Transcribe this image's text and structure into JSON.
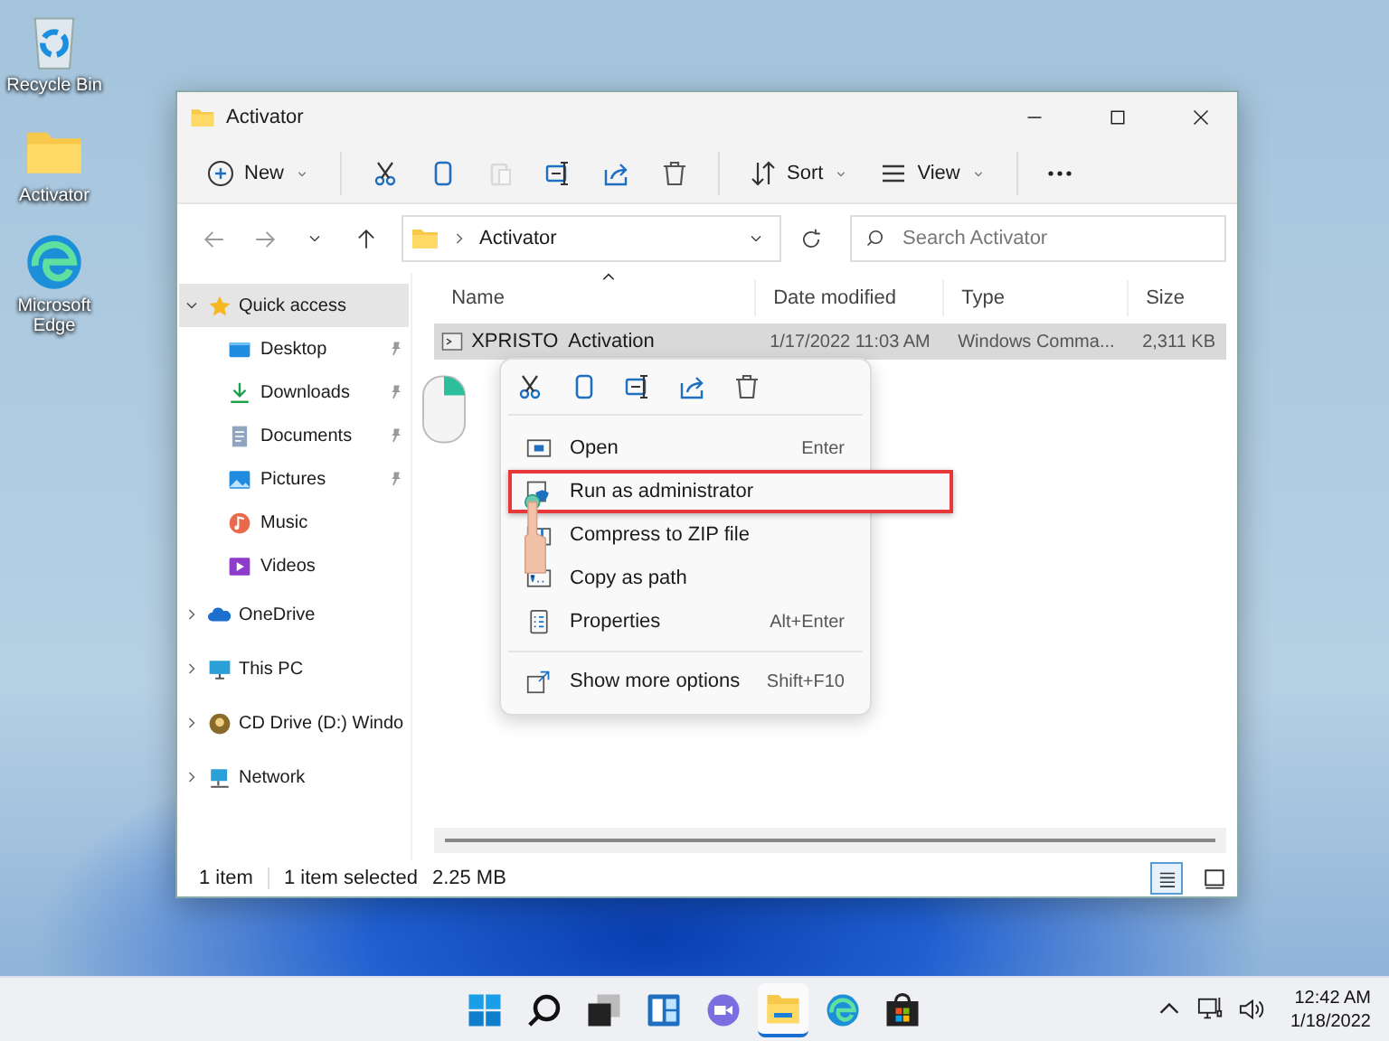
{
  "desktop_icons": [
    {
      "kind": "recycle",
      "label": "Recycle Bin"
    },
    {
      "kind": "folder",
      "label": "Activator"
    },
    {
      "kind": "edge",
      "label": "Microsoft Edge"
    }
  ],
  "window": {
    "title": "Activator",
    "toolbar": [
      {
        "kind": "new",
        "label": "New",
        "disabled": false
      },
      {
        "kind": "cut",
        "disabled": false
      },
      {
        "kind": "copy",
        "disabled": false
      },
      {
        "kind": "paste",
        "disabled": true
      },
      {
        "kind": "rename",
        "disabled": false
      },
      {
        "kind": "share",
        "disabled": false
      },
      {
        "kind": "delete",
        "disabled": false
      },
      {
        "kind": "sort",
        "label": "Sort",
        "disabled": false
      },
      {
        "kind": "view",
        "label": "View",
        "disabled": false
      },
      {
        "kind": "more",
        "disabled": false
      }
    ],
    "address": {
      "crumbs": [
        "Activator"
      ]
    },
    "search": {
      "placeholder": "Search Activator"
    },
    "sidebar": [
      {
        "kind": "star",
        "label": "Quick access",
        "expanded": true,
        "selected": true,
        "children": [
          {
            "kind": "desktop",
            "label": "Desktop",
            "pinned": true,
            "selected": false
          },
          {
            "kind": "download",
            "label": "Downloads",
            "pinned": true,
            "selected": false
          },
          {
            "kind": "document",
            "label": "Documents",
            "pinned": true,
            "selected": false
          },
          {
            "kind": "picture",
            "label": "Pictures",
            "pinned": true,
            "selected": false
          },
          {
            "kind": "music",
            "label": "Music",
            "pinned": false,
            "selected": false
          },
          {
            "kind": "video",
            "label": "Videos",
            "pinned": false,
            "selected": false
          }
        ]
      },
      {
        "kind": "cloud",
        "label": "OneDrive",
        "expanded": false,
        "selected": false
      },
      {
        "kind": "pc",
        "label": "This PC",
        "expanded": false,
        "selected": false
      },
      {
        "kind": "cd",
        "label": "CD Drive (D:) Windo",
        "expanded": false,
        "selected": false
      },
      {
        "kind": "network",
        "label": "Network",
        "expanded": false,
        "selected": false
      }
    ],
    "columns": [
      "Name",
      "Date modified",
      "Type",
      "Size"
    ],
    "rows": [
      {
        "name": "XPRISTO  Activation",
        "date": "1/17/2022 11:03 AM",
        "type": "Windows Comma...",
        "size": "2,311 KB",
        "selected": true
      }
    ],
    "status_bar": {
      "count": "1 item",
      "selection": "1 item selected",
      "size": "2.25 MB"
    },
    "view_buttons": [
      {
        "kind": "details",
        "selected": true
      },
      {
        "kind": "tiles",
        "selected": false
      }
    ]
  },
  "context_menu": {
    "actions": [
      {
        "kind": "cut"
      },
      {
        "kind": "copy"
      },
      {
        "kind": "rename"
      },
      {
        "kind": "share"
      },
      {
        "kind": "delete"
      }
    ],
    "items": [
      {
        "kind": "open",
        "label": "Open",
        "shortcut": "Enter",
        "highlighted": false
      },
      {
        "kind": "admin",
        "label": "Run as administrator",
        "highlighted": true
      },
      {
        "kind": "zip",
        "label": "Compress to ZIP file",
        "highlighted": false
      },
      {
        "kind": "path",
        "label": "Copy as path",
        "highlighted": false
      },
      {
        "kind": "properties",
        "label": "Properties",
        "shortcut": "Alt+Enter",
        "highlighted": false
      },
      {
        "kind": "more",
        "label": "Show more options",
        "shortcut": "Shift+F10",
        "highlighted": false,
        "separated": true
      }
    ]
  },
  "taskbar": {
    "apps": [
      {
        "kind": "start",
        "active": false
      },
      {
        "kind": "search",
        "active": false
      },
      {
        "kind": "taskview",
        "active": false
      },
      {
        "kind": "widgets",
        "active": false
      },
      {
        "kind": "chat",
        "active": false
      },
      {
        "kind": "explorer",
        "active": true
      },
      {
        "kind": "edge",
        "active": false
      },
      {
        "kind": "store",
        "active": false
      }
    ],
    "clock": {
      "time": "12:42 AM",
      "date": "1/18/2022"
    }
  }
}
